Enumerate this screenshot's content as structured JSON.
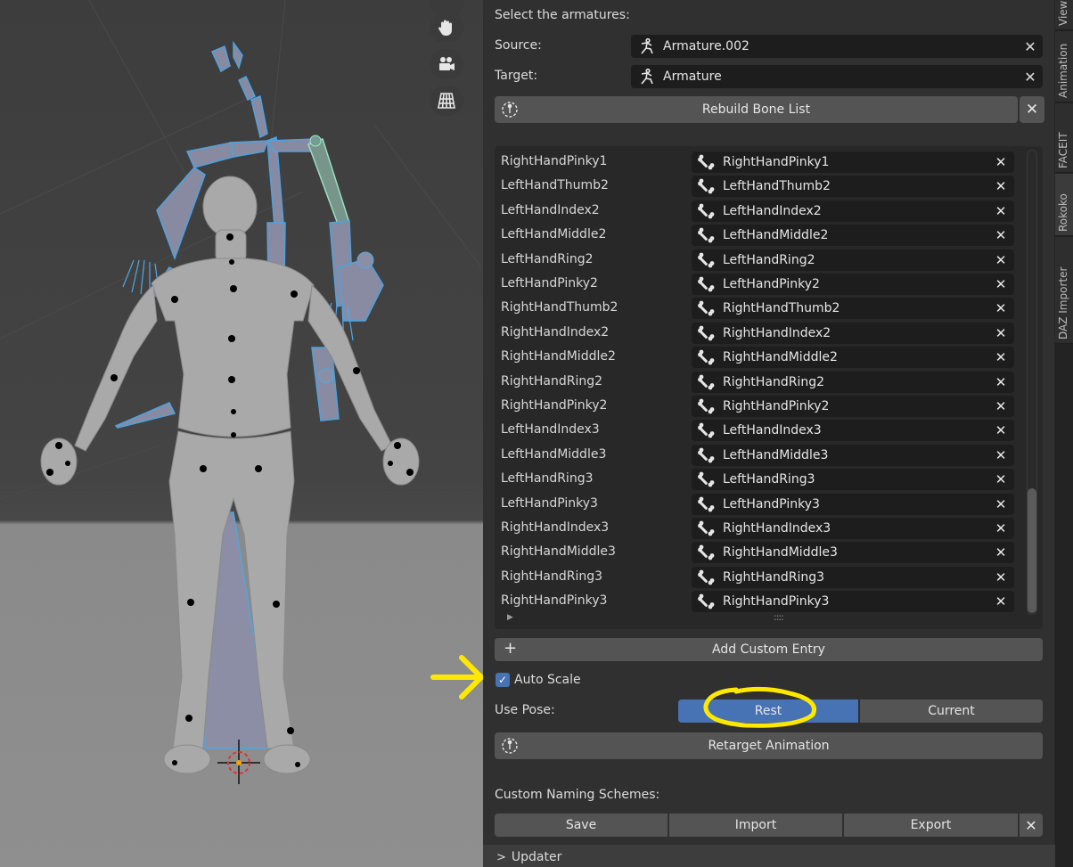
{
  "viewport": {
    "nav_icons": [
      "hand-pan-icon",
      "camera-icon",
      "perspective-grid-icon"
    ]
  },
  "panel": {
    "select_label": "Select the armatures:",
    "source_label": "Source:",
    "source_value": "Armature.002",
    "target_label": "Target:",
    "target_value": "Armature",
    "rebuild_button": "Rebuild Bone List",
    "bone_rows": [
      {
        "source": "RightHandPinky1",
        "target": "RightHandPinky1"
      },
      {
        "source": "LeftHandThumb2",
        "target": "LeftHandThumb2"
      },
      {
        "source": "LeftHandIndex2",
        "target": "LeftHandIndex2"
      },
      {
        "source": "LeftHandMiddle2",
        "target": "LeftHandMiddle2"
      },
      {
        "source": "LeftHandRing2",
        "target": "LeftHandRing2"
      },
      {
        "source": "LeftHandPinky2",
        "target": "LeftHandPinky2"
      },
      {
        "source": "RightHandThumb2",
        "target": "RightHandThumb2"
      },
      {
        "source": "RightHandIndex2",
        "target": "RightHandIndex2"
      },
      {
        "source": "RightHandMiddle2",
        "target": "RightHandMiddle2"
      },
      {
        "source": "RightHandRing2",
        "target": "RightHandRing2"
      },
      {
        "source": "RightHandPinky2",
        "target": "RightHandPinky2"
      },
      {
        "source": "LeftHandIndex3",
        "target": "LeftHandIndex3"
      },
      {
        "source": "LeftHandMiddle3",
        "target": "LeftHandMiddle3"
      },
      {
        "source": "LeftHandRing3",
        "target": "LeftHandRing3"
      },
      {
        "source": "LeftHandPinky3",
        "target": "LeftHandPinky3"
      },
      {
        "source": "RightHandIndex3",
        "target": "RightHandIndex3"
      },
      {
        "source": "RightHandMiddle3",
        "target": "RightHandMiddle3"
      },
      {
        "source": "RightHandRing3",
        "target": "RightHandRing3"
      },
      {
        "source": "RightHandPinky3",
        "target": "RightHandPinky3"
      }
    ],
    "add_custom_entry": "Add Custom Entry",
    "auto_scale_label": "Auto Scale",
    "auto_scale_checked": true,
    "use_pose_label": "Use Pose:",
    "pose_options": [
      "Rest",
      "Current"
    ],
    "pose_selected": "Rest",
    "retarget_button": "Retarget Animation",
    "naming_label": "Custom Naming Schemes:",
    "save_button": "Save",
    "import_button": "Import",
    "export_button": "Export",
    "updater_label": "Updater",
    "close_glyph": "✕",
    "plus_glyph": "+",
    "check_glyph": "✓",
    "chevron_glyph": ">"
  },
  "tabs": [
    "View",
    "Animation",
    "FACEIT",
    "Rokoko",
    "DAZ Importer"
  ],
  "colors": {
    "accent_blue": "#4772b3",
    "panel_bg": "#303030",
    "field_bg": "#1d1d1d",
    "button_bg": "#545454",
    "bone_select": "#4fa8e8",
    "annotation_yellow": "#ffe800"
  }
}
